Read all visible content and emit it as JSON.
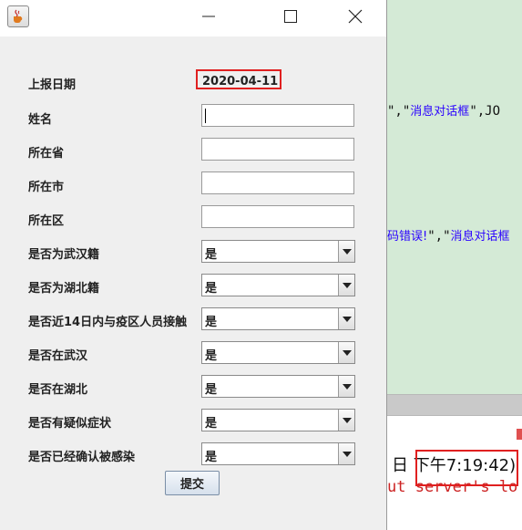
{
  "window": {
    "minimize_symbol": "—",
    "maximize_symbol": "☐",
    "close_symbol": "✕"
  },
  "form": {
    "report_date_label": "上报日期",
    "report_date_value": "2020-04-11",
    "name_label": "姓名",
    "province_label": "所在省",
    "city_label": "所在市",
    "district_label": "所在区",
    "fields": [
      {
        "label": "是否为武汉籍",
        "value": "是"
      },
      {
        "label": "是否为湖北籍",
        "value": "是"
      },
      {
        "label": "是否近14日内与疫区人员接触",
        "value": "是"
      },
      {
        "label": "是否在武汉",
        "value": "是"
      },
      {
        "label": "是否在湖北",
        "value": "是"
      },
      {
        "label": "是否有疑似症状",
        "value": "是"
      },
      {
        "label": "是否已经确认被感染",
        "value": "是"
      }
    ],
    "submit_label": "提交"
  },
  "editor": {
    "line1_prefix": "\",\"",
    "line1_string": "消息对话框",
    "line1_suffix": "\",JO",
    "line2_string": "码错误!",
    "line2_mid": "\",\"",
    "line2_string2": "消息对话框",
    "console_line1_prefix": "日 ",
    "console_line1_time": "下午7:19:42)",
    "console_line2": "ut server's lo"
  },
  "colors": {
    "highlight": "#e02020",
    "editor_bg": "#d4ead6",
    "string_color": "#2a00ff",
    "error_color": "#cc2222"
  },
  "icons": {
    "app": "java-cup-icon",
    "dropdown": "chevron-down-icon"
  }
}
